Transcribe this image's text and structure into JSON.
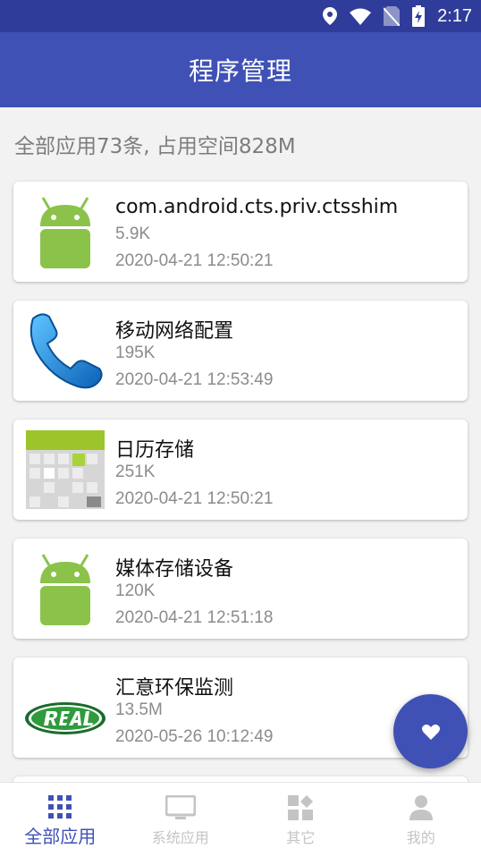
{
  "status_bar": {
    "time": "2:17"
  },
  "app_bar": {
    "title": "程序管理"
  },
  "summary": "全部应用73条, 占用空间828M",
  "apps": [
    {
      "name": "com.android.cts.priv.ctsshim",
      "size": "5.9K",
      "date": "2020-04-21 12:50:21",
      "icon": "android-robot-icon"
    },
    {
      "name": "移动网络配置",
      "size": "195K",
      "date": "2020-04-21 12:53:49",
      "icon": "phone-handset-icon"
    },
    {
      "name": "日历存储",
      "size": "251K",
      "date": "2020-04-21 12:50:21",
      "icon": "calendar-icon"
    },
    {
      "name": "媒体存储设备",
      "size": "120K",
      "date": "2020-04-21 12:51:18",
      "icon": "android-robot-icon"
    },
    {
      "name": "汇意环保监测",
      "size": "13.5M",
      "date": "2020-05-26 10:12:49",
      "icon": "real-logo-icon"
    }
  ],
  "fab": {
    "icon": "heart-icon"
  },
  "bottom_nav": [
    {
      "label": "全部应用",
      "icon": "grid-icon",
      "active": true
    },
    {
      "label": "系统应用",
      "icon": "monitor-icon",
      "active": false
    },
    {
      "label": "其它",
      "icon": "apps-icon",
      "active": false
    },
    {
      "label": "我的",
      "icon": "person-icon",
      "active": false
    }
  ],
  "colors": {
    "primary": "#3f51b5",
    "status_bar": "#2f3c9a",
    "android_green": "#8bc34a",
    "inactive": "#c4c4c4"
  }
}
